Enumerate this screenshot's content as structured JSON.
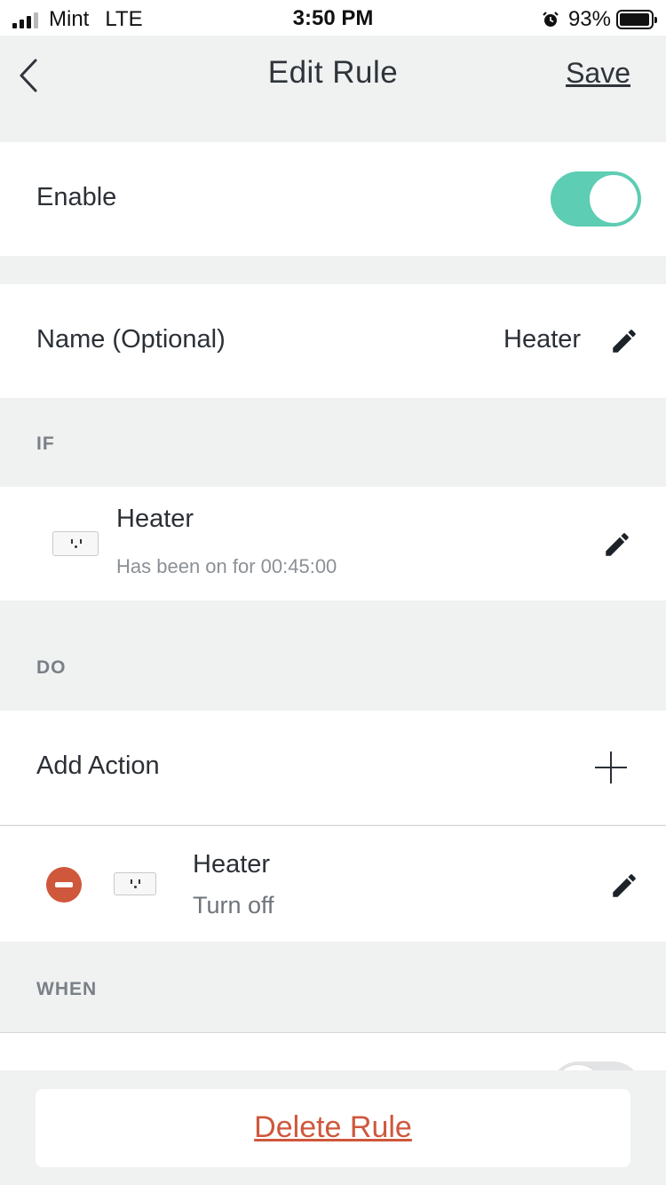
{
  "status_bar": {
    "carrier": "Mint",
    "network": "LTE",
    "time": "3:50 PM",
    "battery": "93%"
  },
  "nav": {
    "title": "Edit Rule",
    "save_label": "Save"
  },
  "enable": {
    "label": "Enable",
    "on": true
  },
  "name": {
    "label": "Name (Optional)",
    "value": "Heater"
  },
  "if_section": {
    "header": "IF",
    "device_name": "Heater",
    "condition": "Has been on for 00:45:00"
  },
  "do_section": {
    "header": "DO",
    "add_action_label": "Add Action",
    "action_device": "Heater",
    "action_value": "Turn off"
  },
  "when_section": {
    "header": "WHEN"
  },
  "footer": {
    "delete_label": "Delete Rule"
  },
  "colors": {
    "accent_toggle": "#5dcdb3",
    "danger": "#cf573c",
    "background": "#f0f1f1"
  }
}
